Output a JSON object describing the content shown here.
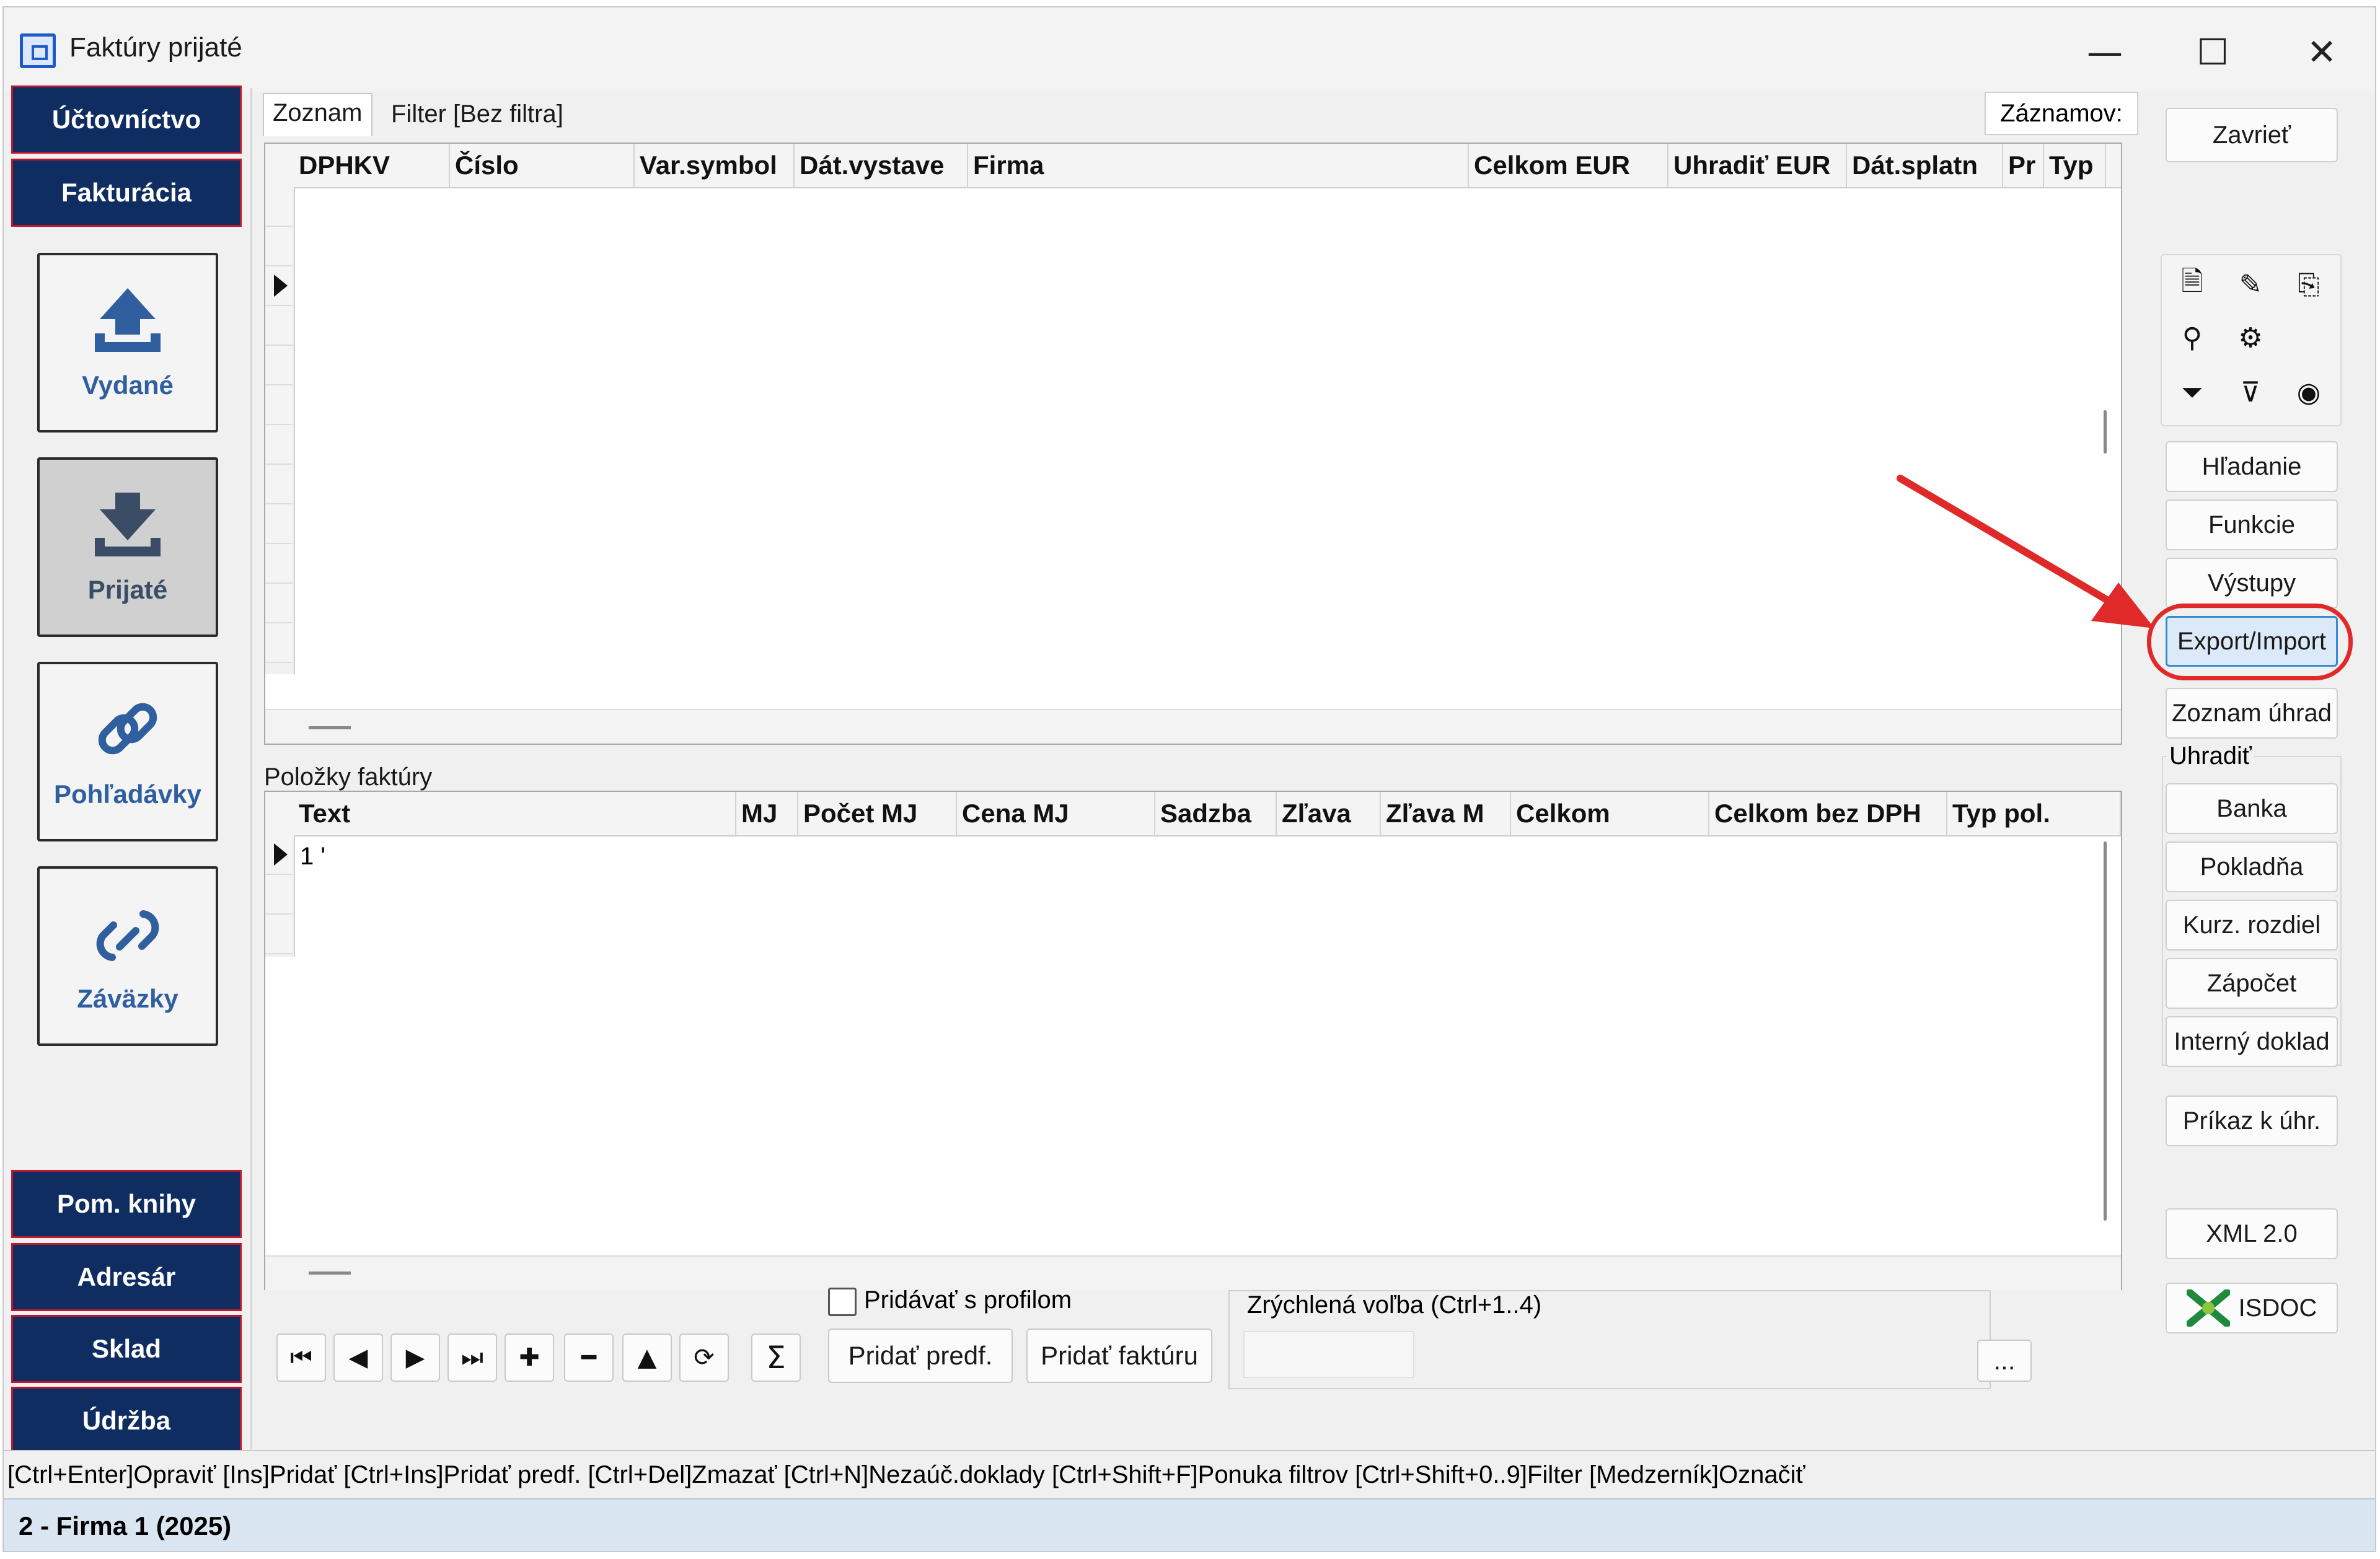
{
  "window": {
    "title": "Faktúry prijaté",
    "minimize": "—",
    "maximize": "☐",
    "close": "✕"
  },
  "nav": {
    "top": [
      "Účtovníctvo",
      "Fakturácia"
    ],
    "tiles": [
      {
        "label": "Vydané",
        "icon": "upload-icon"
      },
      {
        "label": "Prijaté",
        "icon": "download-icon",
        "selected": true
      },
      {
        "label": "Pohľadávky",
        "icon": "link-icon"
      },
      {
        "label": "Záväzky",
        "icon": "link-broken-icon"
      }
    ],
    "bottom": [
      "Pom. knihy",
      "Adresár",
      "Sklad",
      "Údržba"
    ]
  },
  "tabs": {
    "list": "Zoznam",
    "filter": "Filter [Bez filtra]",
    "records": "Záznamov:"
  },
  "invoices_grid": {
    "columns": [
      "DPHKV",
      "Číslo",
      "Var.symbol",
      "Dát.vystave",
      "Firma",
      "Celkom EUR",
      "Uhradiť EUR",
      "Dát.splatn",
      "Pr",
      "Typ"
    ],
    "rows": []
  },
  "items": {
    "label": "Položky faktúry",
    "columns": [
      "Text",
      "MJ",
      "Počet MJ",
      "Cena MJ",
      "Sadzba",
      "Zľava",
      "Zľava M",
      "Celkom",
      "Celkom bez DPH",
      "Typ pol."
    ],
    "rows": [
      {
        "text": "1 '"
      }
    ]
  },
  "bottom_controls": {
    "checkbox_label": "Pridávať s profilom",
    "checkbox_checked": false,
    "add_template": "Pridať predf.",
    "add_invoice": "Pridať faktúru",
    "quick_label": "Zrýchlená voľba (Ctrl+1..4)",
    "more": "...",
    "sum": "Σ"
  },
  "right_panel": {
    "close": "Zavrieť",
    "search": "Hľadanie",
    "functions": "Funkcie",
    "outputs": "Výstupy",
    "export_import": "Export/Import",
    "payments_list": "Zoznam úhrad",
    "uhradit_label": "Uhradiť",
    "uhradit_buttons": [
      "Banka",
      "Pokladňa",
      "Kurz. rozdiel",
      "Zápočet",
      "Interný doklad"
    ],
    "payment_order": "Príkaz k úhr.",
    "xml": "XML 2.0",
    "isdoc": "ISDOC"
  },
  "status": {
    "hint": "[Ctrl+Enter]Opraviť [Ins]Pridať [Ctrl+Ins]Pridať predf.  [Ctrl+Del]Zmazať [Ctrl+N]Nezaúč.doklady  [Ctrl+Shift+F]Ponuka filtrov [Ctrl+Shift+0..9]Filter  [Medzerník]Označiť",
    "company": "2 - Firma 1 (2025)"
  },
  "colors": {
    "nav_bg": "#0f2d60",
    "nav_border": "#c0182a",
    "accent_red": "#e02a2a",
    "selected_blue": "#dce9f8"
  }
}
